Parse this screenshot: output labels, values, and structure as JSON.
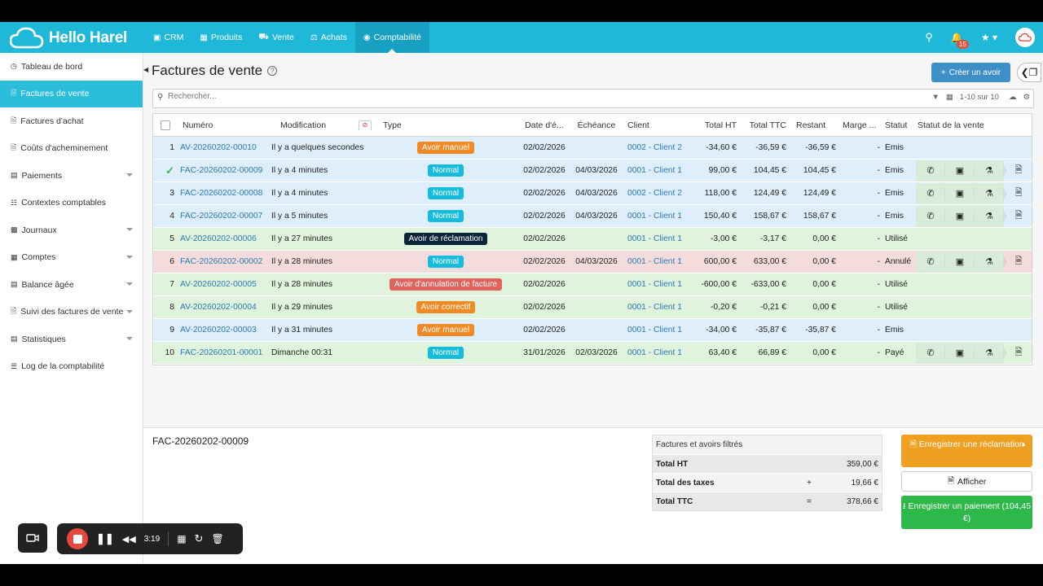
{
  "app": {
    "name": "Hello Harel"
  },
  "nav": [
    {
      "label": "CRM",
      "icon": "building-icon"
    },
    {
      "label": "Produits",
      "icon": "grid-icon"
    },
    {
      "label": "Vente",
      "icon": "truck-icon"
    },
    {
      "label": "Achats",
      "icon": "scale-icon"
    },
    {
      "label": "Comptabilité",
      "icon": "piggy-bank-icon"
    }
  ],
  "notifications_count": "15",
  "sidebar": [
    {
      "label": "Tableau de bord",
      "icon": "dashboard-icon",
      "caret": false
    },
    {
      "label": "Factures de vente",
      "icon": "file-icon",
      "caret": false,
      "active": true
    },
    {
      "label": "Factures d'achat",
      "icon": "file-icon",
      "caret": false
    },
    {
      "label": "Coûts d'acheminement",
      "icon": "file-icon",
      "caret": false
    },
    {
      "label": "Paiements",
      "icon": "money-icon",
      "caret": true
    },
    {
      "label": "Contextes comptables",
      "icon": "sitemap-icon",
      "caret": false
    },
    {
      "label": "Journaux",
      "icon": "book-icon",
      "caret": true
    },
    {
      "label": "Comptes",
      "icon": "table-icon",
      "caret": true
    },
    {
      "label": "Balance âgée",
      "icon": "balance-icon",
      "caret": true
    },
    {
      "label": "Suivi des factures de vente",
      "icon": "file-icon",
      "caret": true
    },
    {
      "label": "Statistiques",
      "icon": "chart-icon",
      "caret": true
    },
    {
      "label": "Log de la comptabilité",
      "icon": "list-icon",
      "caret": false
    }
  ],
  "page": {
    "title": "Factures de vente",
    "help": "?",
    "create_button": "Créer un avoir",
    "search_placeholder": "Rechercher...",
    "pagination": "1-10 sur 10"
  },
  "columns": [
    "Numéro",
    "Modification",
    "Type",
    "Date d'é...",
    "Échéance",
    "Client",
    "Total HT",
    "Total TTC",
    "Restant",
    "Marge ...",
    "Statut",
    "Statut de la vente"
  ],
  "rows": [
    {
      "idx": "1",
      "num": "AV-20260202-00010",
      "mod": "Il y a quelques secondes",
      "type": "Avoir manuel",
      "tagcolor": "orange",
      "date": "02/02/2026",
      "ech": "",
      "client": "0002 - Client 2",
      "ht": "-34,60 €",
      "ttc": "-36,59 €",
      "rest": "-36,59 €",
      "marge": "-",
      "statut": "Émis",
      "bg": "blue",
      "steps": false,
      "checked": false
    },
    {
      "idx": "",
      "num": "FAC-20260202-00009",
      "mod": "Il y a 4 minutes",
      "type": "Normal",
      "tagcolor": "cyan",
      "date": "02/02/2026",
      "ech": "04/03/2026",
      "client": "0001 - Client 1",
      "ht": "99,00 €",
      "ttc": "104,45 €",
      "rest": "104,45 €",
      "marge": "-",
      "statut": "Émis",
      "bg": "blue",
      "steps": true,
      "checked": true
    },
    {
      "idx": "3",
      "num": "FAC-20260202-00008",
      "mod": "Il y a 4 minutes",
      "type": "Normal",
      "tagcolor": "cyan",
      "date": "02/02/2026",
      "ech": "04/03/2026",
      "client": "0002 - Client 2",
      "ht": "118,00 €",
      "ttc": "124,49 €",
      "rest": "124,49 €",
      "marge": "-",
      "statut": "Émis",
      "bg": "blue",
      "steps": true,
      "checked": false
    },
    {
      "idx": "4",
      "num": "FAC-20260202-00007",
      "mod": "Il y a 5 minutes",
      "type": "Normal",
      "tagcolor": "cyan",
      "date": "02/02/2026",
      "ech": "04/03/2026",
      "client": "0001 - Client 1",
      "ht": "150,40 €",
      "ttc": "158,67 €",
      "rest": "158,67 €",
      "marge": "-",
      "statut": "Émis",
      "bg": "blue",
      "steps": true,
      "checked": false
    },
    {
      "idx": "5",
      "num": "AV-20260202-00006",
      "mod": "Il y a 27 minutes",
      "type": "Avoir de réclamation",
      "tagcolor": "dark",
      "date": "02/02/2026",
      "ech": "",
      "client": "0001 - Client 1",
      "ht": "-3,00 €",
      "ttc": "-3,17 €",
      "rest": "0,00 €",
      "marge": "-",
      "statut": "Utilisé",
      "bg": "green",
      "steps": false,
      "checked": false
    },
    {
      "idx": "6",
      "num": "FAC-20260202-00002",
      "mod": "Il y a 28 minutes",
      "type": "Normal",
      "tagcolor": "cyan",
      "date": "02/02/2026",
      "ech": "04/03/2026",
      "client": "0001 - Client 1",
      "ht": "600,00 €",
      "ttc": "633,00 €",
      "rest": "0,00 €",
      "marge": "-",
      "statut": "Annulé",
      "bg": "red",
      "steps": true,
      "checked": false
    },
    {
      "idx": "7",
      "num": "AV-20260202-00005",
      "mod": "Il y a 28 minutes",
      "type": "Avoir d'annulation de facture",
      "tagcolor": "red",
      "date": "02/02/2026",
      "ech": "",
      "client": "0001 - Client 1",
      "ht": "-600,00 €",
      "ttc": "-633,00 €",
      "rest": "0,00 €",
      "marge": "-",
      "statut": "Utilisé",
      "bg": "green",
      "steps": false,
      "checked": false
    },
    {
      "idx": "8",
      "num": "AV-20260202-00004",
      "mod": "Il y a 29 minutes",
      "type": "Avoir correctif",
      "tagcolor": "orange",
      "date": "02/02/2026",
      "ech": "",
      "client": "0001 - Client 1",
      "ht": "-0,20 €",
      "ttc": "-0,21 €",
      "rest": "0,00 €",
      "marge": "-",
      "statut": "Utilisé",
      "bg": "green",
      "steps": false,
      "checked": false
    },
    {
      "idx": "9",
      "num": "AV-20260202-00003",
      "mod": "Il y a 31 minutes",
      "type": "Avoir manuel",
      "tagcolor": "orange",
      "date": "02/02/2026",
      "ech": "",
      "client": "0001 - Client 1",
      "ht": "-34,00 €",
      "ttc": "-35,87 €",
      "rest": "-35,87 €",
      "marge": "-",
      "statut": "Émis",
      "bg": "blue",
      "steps": false,
      "checked": false
    },
    {
      "idx": "10",
      "num": "FAC-20260201-00001",
      "mod": "Dimanche 00:31",
      "type": "Normal",
      "tagcolor": "cyan",
      "date": "31/01/2026",
      "ech": "02/03/2026",
      "client": "0001 - Client 1",
      "ht": "63,40 €",
      "ttc": "66,89 €",
      "rest": "0,00 €",
      "marge": "-",
      "statut": "Payé",
      "bg": "green",
      "steps": true,
      "checked": false
    }
  ],
  "selected_invoice": "FAC-20260202-00009",
  "summary": {
    "title": "Factures et avoirs filtrés",
    "rows": [
      {
        "label": "Total HT",
        "op": "",
        "value": "359,00 €"
      },
      {
        "label": "Total des taxes",
        "op": "+",
        "value": "19,66 €"
      },
      {
        "label": "Total TTC",
        "op": "=",
        "value": "378,66 €"
      }
    ]
  },
  "actions": {
    "reclamation": "Enregistrer une réclamation",
    "afficher": "Afficher",
    "paiement": "Enregistrer un paiement (104,45 €)"
  },
  "recorder": {
    "time": "3:19"
  },
  "colors": {
    "topbar": "#1fb8d8",
    "active_sidebar": "#2cbcdc",
    "primary": "#3e8ec8",
    "orange": "#f08a24",
    "cyan": "#16bcdc",
    "green": "#2fb84a"
  }
}
